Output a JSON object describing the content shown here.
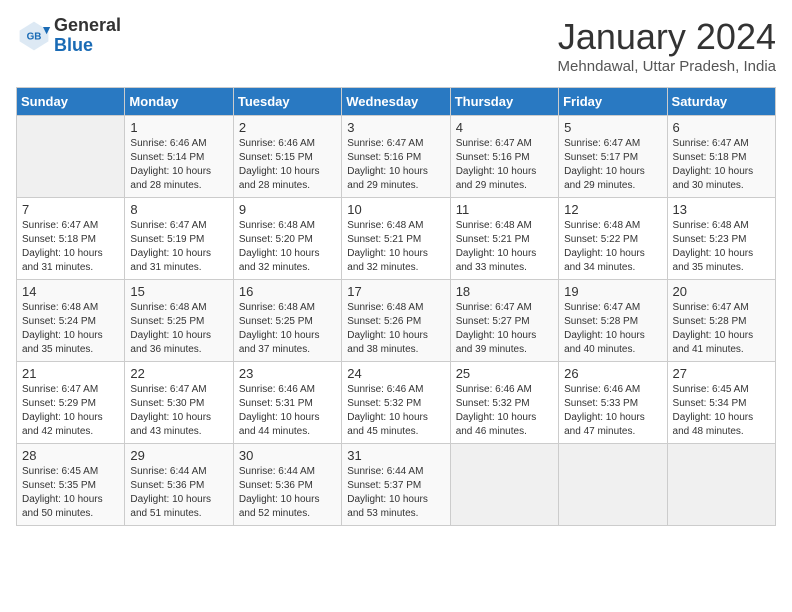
{
  "header": {
    "logo_general": "General",
    "logo_blue": "Blue",
    "month_title": "January 2024",
    "subtitle": "Mehndawal, Uttar Pradesh, India"
  },
  "days_of_week": [
    "Sunday",
    "Monday",
    "Tuesday",
    "Wednesday",
    "Thursday",
    "Friday",
    "Saturday"
  ],
  "weeks": [
    [
      {
        "num": "",
        "info": ""
      },
      {
        "num": "1",
        "info": "Sunrise: 6:46 AM\nSunset: 5:14 PM\nDaylight: 10 hours\nand 28 minutes."
      },
      {
        "num": "2",
        "info": "Sunrise: 6:46 AM\nSunset: 5:15 PM\nDaylight: 10 hours\nand 28 minutes."
      },
      {
        "num": "3",
        "info": "Sunrise: 6:47 AM\nSunset: 5:16 PM\nDaylight: 10 hours\nand 29 minutes."
      },
      {
        "num": "4",
        "info": "Sunrise: 6:47 AM\nSunset: 5:16 PM\nDaylight: 10 hours\nand 29 minutes."
      },
      {
        "num": "5",
        "info": "Sunrise: 6:47 AM\nSunset: 5:17 PM\nDaylight: 10 hours\nand 29 minutes."
      },
      {
        "num": "6",
        "info": "Sunrise: 6:47 AM\nSunset: 5:18 PM\nDaylight: 10 hours\nand 30 minutes."
      }
    ],
    [
      {
        "num": "7",
        "info": "Sunrise: 6:47 AM\nSunset: 5:18 PM\nDaylight: 10 hours\nand 31 minutes."
      },
      {
        "num": "8",
        "info": "Sunrise: 6:47 AM\nSunset: 5:19 PM\nDaylight: 10 hours\nand 31 minutes."
      },
      {
        "num": "9",
        "info": "Sunrise: 6:48 AM\nSunset: 5:20 PM\nDaylight: 10 hours\nand 32 minutes."
      },
      {
        "num": "10",
        "info": "Sunrise: 6:48 AM\nSunset: 5:21 PM\nDaylight: 10 hours\nand 32 minutes."
      },
      {
        "num": "11",
        "info": "Sunrise: 6:48 AM\nSunset: 5:21 PM\nDaylight: 10 hours\nand 33 minutes."
      },
      {
        "num": "12",
        "info": "Sunrise: 6:48 AM\nSunset: 5:22 PM\nDaylight: 10 hours\nand 34 minutes."
      },
      {
        "num": "13",
        "info": "Sunrise: 6:48 AM\nSunset: 5:23 PM\nDaylight: 10 hours\nand 35 minutes."
      }
    ],
    [
      {
        "num": "14",
        "info": "Sunrise: 6:48 AM\nSunset: 5:24 PM\nDaylight: 10 hours\nand 35 minutes."
      },
      {
        "num": "15",
        "info": "Sunrise: 6:48 AM\nSunset: 5:25 PM\nDaylight: 10 hours\nand 36 minutes."
      },
      {
        "num": "16",
        "info": "Sunrise: 6:48 AM\nSunset: 5:25 PM\nDaylight: 10 hours\nand 37 minutes."
      },
      {
        "num": "17",
        "info": "Sunrise: 6:48 AM\nSunset: 5:26 PM\nDaylight: 10 hours\nand 38 minutes."
      },
      {
        "num": "18",
        "info": "Sunrise: 6:47 AM\nSunset: 5:27 PM\nDaylight: 10 hours\nand 39 minutes."
      },
      {
        "num": "19",
        "info": "Sunrise: 6:47 AM\nSunset: 5:28 PM\nDaylight: 10 hours\nand 40 minutes."
      },
      {
        "num": "20",
        "info": "Sunrise: 6:47 AM\nSunset: 5:28 PM\nDaylight: 10 hours\nand 41 minutes."
      }
    ],
    [
      {
        "num": "21",
        "info": "Sunrise: 6:47 AM\nSunset: 5:29 PM\nDaylight: 10 hours\nand 42 minutes."
      },
      {
        "num": "22",
        "info": "Sunrise: 6:47 AM\nSunset: 5:30 PM\nDaylight: 10 hours\nand 43 minutes."
      },
      {
        "num": "23",
        "info": "Sunrise: 6:46 AM\nSunset: 5:31 PM\nDaylight: 10 hours\nand 44 minutes."
      },
      {
        "num": "24",
        "info": "Sunrise: 6:46 AM\nSunset: 5:32 PM\nDaylight: 10 hours\nand 45 minutes."
      },
      {
        "num": "25",
        "info": "Sunrise: 6:46 AM\nSunset: 5:32 PM\nDaylight: 10 hours\nand 46 minutes."
      },
      {
        "num": "26",
        "info": "Sunrise: 6:46 AM\nSunset: 5:33 PM\nDaylight: 10 hours\nand 47 minutes."
      },
      {
        "num": "27",
        "info": "Sunrise: 6:45 AM\nSunset: 5:34 PM\nDaylight: 10 hours\nand 48 minutes."
      }
    ],
    [
      {
        "num": "28",
        "info": "Sunrise: 6:45 AM\nSunset: 5:35 PM\nDaylight: 10 hours\nand 50 minutes."
      },
      {
        "num": "29",
        "info": "Sunrise: 6:44 AM\nSunset: 5:36 PM\nDaylight: 10 hours\nand 51 minutes."
      },
      {
        "num": "30",
        "info": "Sunrise: 6:44 AM\nSunset: 5:36 PM\nDaylight: 10 hours\nand 52 minutes."
      },
      {
        "num": "31",
        "info": "Sunrise: 6:44 AM\nSunset: 5:37 PM\nDaylight: 10 hours\nand 53 minutes."
      },
      {
        "num": "",
        "info": ""
      },
      {
        "num": "",
        "info": ""
      },
      {
        "num": "",
        "info": ""
      }
    ]
  ]
}
